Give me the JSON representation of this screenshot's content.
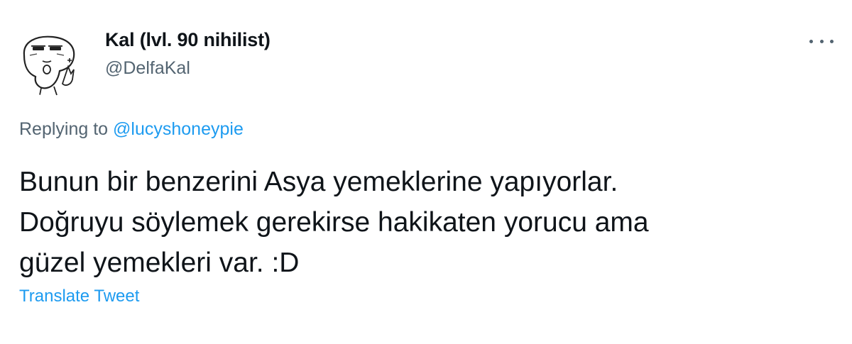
{
  "tweet": {
    "author": {
      "display_name": "Kal (lvl. 90 nihilist)",
      "handle": "@DelfaKal",
      "avatar_icon": "cartoon-face-avatar-icon"
    },
    "more_icon": "more-options-icon",
    "reply": {
      "prefix": "Replying to",
      "mention": "@lucyshoneypie"
    },
    "text_lines": [
      "Bunun bir benzerini Asya yemeklerine yapıyorlar.",
      "Doğruyu söylemek gerekirse hakikaten yorucu ama",
      "güzel yemekleri var. :D"
    ],
    "translate_label": "Translate Tweet"
  },
  "colors": {
    "text_primary": "#0f1419",
    "text_secondary": "#536471",
    "link": "#1d9bf0",
    "background": "#ffffff"
  }
}
